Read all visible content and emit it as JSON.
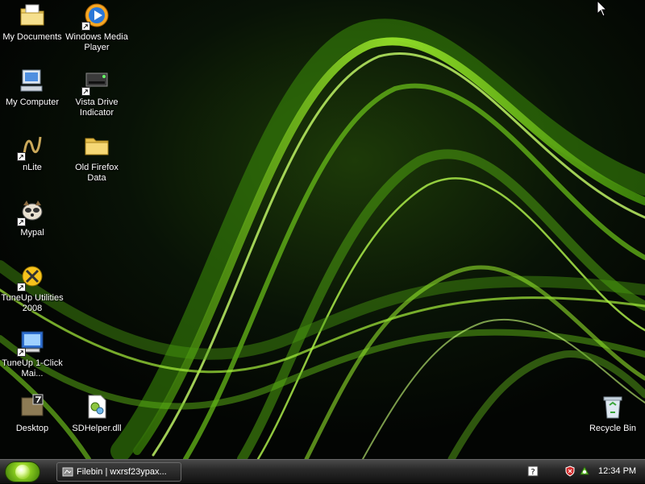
{
  "desktop": {
    "icons": [
      {
        "label": "My Documents",
        "icon": "my-documents-icon"
      },
      {
        "label": "Windows Media Player",
        "icon": "media-player-icon"
      },
      {
        "label": "My Computer",
        "icon": "my-computer-icon"
      },
      {
        "label": "Vista Drive Indicator",
        "icon": "drive-indicator-icon"
      },
      {
        "label": "nLite",
        "icon": "nlite-icon"
      },
      {
        "label": "Old Firefox Data",
        "icon": "folder-icon"
      },
      {
        "label": "Mypal",
        "icon": "mypal-icon"
      },
      {
        "label": "TuneUp Utilities 2008",
        "icon": "tuneup-icon"
      },
      {
        "label": "TuneUp 1-Click Mai...",
        "icon": "tuneup-1click-icon"
      },
      {
        "label": "Desktop",
        "icon": "desktop-folder-icon"
      },
      {
        "label": "SDHelper.dll",
        "icon": "dll-file-icon"
      },
      {
        "label": "Recycle Bin",
        "icon": "recycle-bin-icon"
      }
    ]
  },
  "taskbar": {
    "tasks": [
      {
        "label": "Filebin | wxrsf23ypax..."
      }
    ],
    "clock": "12:34 PM"
  },
  "colors": {
    "accent": "#7fd31a",
    "wallpaper_bg": "#050805",
    "taskbar_bg": "#2a2a2a"
  }
}
